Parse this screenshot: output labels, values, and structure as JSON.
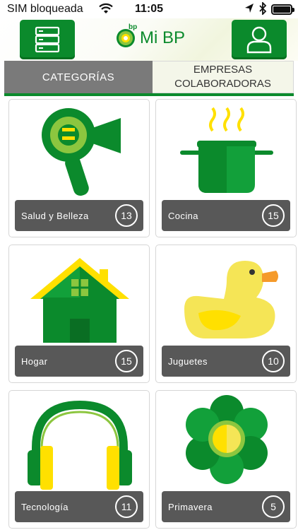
{
  "status_bar": {
    "carrier": "SIM bloqueada",
    "time": "11:05"
  },
  "header": {
    "logo_small": "bp",
    "title": "Mi BP",
    "menu_icon": "server-stack-icon",
    "profile_icon": "user-icon"
  },
  "tabs": [
    {
      "label": "CATEGORÍAS",
      "active": true
    },
    {
      "label_line1": "EMPRESAS",
      "label_line2": "COLABORADORAS",
      "active": false
    }
  ],
  "categories": [
    {
      "label": "Salud y Belleza",
      "count": "13",
      "icon": "hair-dryer-icon"
    },
    {
      "label": "Cocina",
      "count": "15",
      "icon": "cooking-pot-icon"
    },
    {
      "label": "Hogar",
      "count": "15",
      "icon": "house-icon"
    },
    {
      "label": "Juguetes",
      "count": "10",
      "icon": "rubber-duck-icon"
    },
    {
      "label": "Tecnología",
      "count": "11",
      "icon": "headphones-icon"
    },
    {
      "label": "Primavera",
      "count": "5",
      "icon": "flower-icon"
    }
  ],
  "colors": {
    "brand_green": "#0b8a2c",
    "brand_yellow": "#ffe000",
    "label_bar": "#585858"
  }
}
